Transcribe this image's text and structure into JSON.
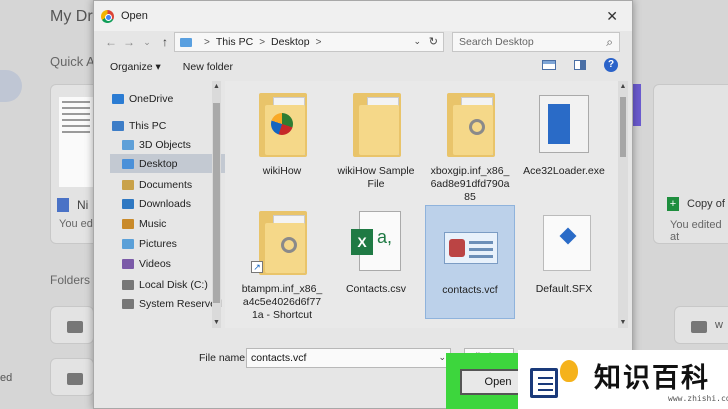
{
  "background": {
    "drive_title": "My Dri",
    "quick_access": "Quick A",
    "card_left_title": "Ni",
    "card_left_meta": "You edi",
    "card_right_title": "Copy of",
    "card_right_meta": "You edited at",
    "folders_label": "Folders",
    "folder_left_text": "ed",
    "folder_right_text": "w"
  },
  "dialog": {
    "title": "Open",
    "close_label": "✕",
    "nav": {
      "back": "←",
      "forward": "→",
      "recent": "⌄",
      "up": "↑"
    },
    "address": {
      "crumbs": [
        "This PC",
        "Desktop"
      ],
      "separator": ">",
      "dropdown": "⌄",
      "refresh": "↻"
    },
    "search_placeholder": "Search Desktop",
    "toolbar": {
      "organize": "Organize ▾",
      "new_folder": "New folder",
      "help": "?"
    },
    "nav_pane": [
      {
        "label": "OneDrive",
        "icon": "cloud-icon",
        "color": "#2b7cd3",
        "indent": 0,
        "selected": false
      },
      {
        "label": "This PC",
        "icon": "computer-icon",
        "color": "#3d7dc7",
        "indent": 0,
        "selected": false
      },
      {
        "label": "3D Objects",
        "icon": "cube-icon",
        "color": "#5fa0d8",
        "indent": 1,
        "selected": false
      },
      {
        "label": "Desktop",
        "icon": "desktop-folder-icon",
        "color": "#4a90d9",
        "indent": 1,
        "selected": true
      },
      {
        "label": "Documents",
        "icon": "documents-folder-icon",
        "color": "#c9a24a",
        "indent": 1,
        "selected": false
      },
      {
        "label": "Downloads",
        "icon": "downloads-folder-icon",
        "color": "#2f78c2",
        "indent": 1,
        "selected": false
      },
      {
        "label": "Music",
        "icon": "music-folder-icon",
        "color": "#c98a2a",
        "indent": 1,
        "selected": false
      },
      {
        "label": "Pictures",
        "icon": "pictures-folder-icon",
        "color": "#5ba0d8",
        "indent": 1,
        "selected": false
      },
      {
        "label": "Videos",
        "icon": "videos-folder-icon",
        "color": "#7b5aa8",
        "indent": 1,
        "selected": false
      },
      {
        "label": "Local Disk (C:)",
        "icon": "disk-icon",
        "color": "#777777",
        "indent": 1,
        "selected": false
      },
      {
        "label": "System Reserved",
        "icon": "disk-icon",
        "color": "#777777",
        "indent": 1,
        "selected": false
      }
    ],
    "files": [
      {
        "label": "wikiHow",
        "kind": "folder-wikihow",
        "selected": false
      },
      {
        "label": "wikiHow Sample File",
        "kind": "folder",
        "selected": false
      },
      {
        "label": "xboxgip.inf_x86_6ad8e91dfd790a85",
        "kind": "folder-gear",
        "selected": false
      },
      {
        "label": "Ace32Loader.exe",
        "kind": "exe",
        "selected": false
      },
      {
        "label": "btampm.inf_x86_a4c5e4026d6f771a - Shortcut",
        "kind": "folder-shortcut",
        "selected": false
      },
      {
        "label": "Contacts.csv",
        "kind": "csv",
        "selected": false
      },
      {
        "label": "contacts.vcf",
        "kind": "vcf",
        "selected": true
      },
      {
        "label": "Default.SFX",
        "kind": "sfx",
        "selected": false
      }
    ],
    "file_name_label": "File name:",
    "file_name_value": "contacts.vcf",
    "file_type_value": "All Fi",
    "open_button": "Open"
  },
  "watermark": {
    "text": "知识百科",
    "url": "www.zhishi.com"
  },
  "colors": {
    "highlight_green": "#3dd63d",
    "selection_blue": "#bcd1ea"
  }
}
